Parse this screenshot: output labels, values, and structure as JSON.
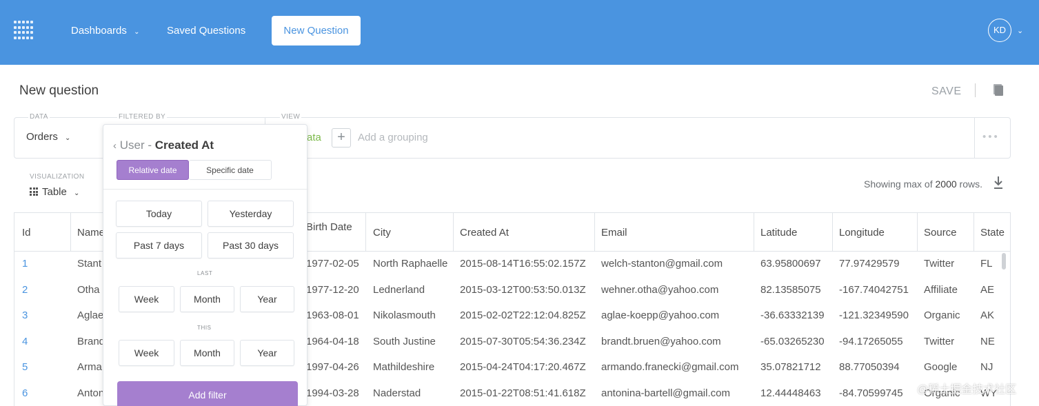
{
  "nav": {
    "dashboards": "Dashboards",
    "saved_questions": "Saved Questions",
    "new_question": "New Question",
    "avatar_initials": "KD"
  },
  "header": {
    "title": "New question",
    "save": "SAVE"
  },
  "builder": {
    "data_label": "DATA",
    "data_value": "Orders",
    "filtered_label": "FILTERED BY",
    "view_label": "VIEW",
    "view_value_partial": "ata",
    "add_grouping": "Add a grouping"
  },
  "visualization": {
    "label": "VISUALIZATION",
    "value": "Table",
    "row_prefix": "Showing max of",
    "row_count": "2000",
    "row_suffix": "rows."
  },
  "filter_popover": {
    "back_label": "User -",
    "field": "Created At",
    "tab_relative": "Relative date",
    "tab_specific": "Specific date",
    "today": "Today",
    "yesterday": "Yesterday",
    "past7": "Past 7 days",
    "past30": "Past 30 days",
    "last_label": "LAST",
    "this_label": "THIS",
    "week": "Week",
    "month": "Month",
    "year": "Year",
    "add_filter": "Add filter"
  },
  "table": {
    "columns": [
      "Id",
      "Name",
      "Birth Date",
      "City",
      "Created At",
      "Email",
      "Latitude",
      "Longitude",
      "Source",
      "State"
    ],
    "rows": [
      [
        "1",
        "Stant",
        "1977-02-05",
        "North Raphaelle",
        "2015-08-14T16:55:02.157Z",
        "welch-stanton@gmail.com",
        "63.95800697",
        "77.97429579",
        "Twitter",
        "FL"
      ],
      [
        "2",
        "Otha",
        "1977-12-20",
        "Lednerland",
        "2015-03-12T00:53:50.013Z",
        "wehner.otha@yahoo.com",
        "82.13585075",
        "-167.74042751",
        "Affiliate",
        "AE"
      ],
      [
        "3",
        "Aglae",
        "1963-08-01",
        "Nikolasmouth",
        "2015-02-02T22:12:04.825Z",
        "aglae-koepp@yahoo.com",
        "-36.63332139",
        "-121.32349590",
        "Organic",
        "AK"
      ],
      [
        "4",
        "Brand",
        "1964-04-18",
        "South Justine",
        "2015-07-30T05:54:36.234Z",
        "brandt.bruen@yahoo.com",
        "-65.03265230",
        "-94.17265055",
        "Twitter",
        "NE"
      ],
      [
        "5",
        "Arma",
        "1997-04-26",
        "Mathildeshire",
        "2015-04-24T04:17:20.467Z",
        "armando.franecki@gmail.com",
        "35.07821712",
        "88.77050394",
        "Google",
        "NJ"
      ],
      [
        "6",
        "Anton",
        "1994-03-28",
        "Naderstad",
        "2015-01-22T08:51:41.618Z",
        "antonina-bartell@gmail.com",
        "12.44448463",
        "-84.70599745",
        "Organic",
        "WY"
      ]
    ]
  },
  "watermark": "@稀土掘金技术社区"
}
